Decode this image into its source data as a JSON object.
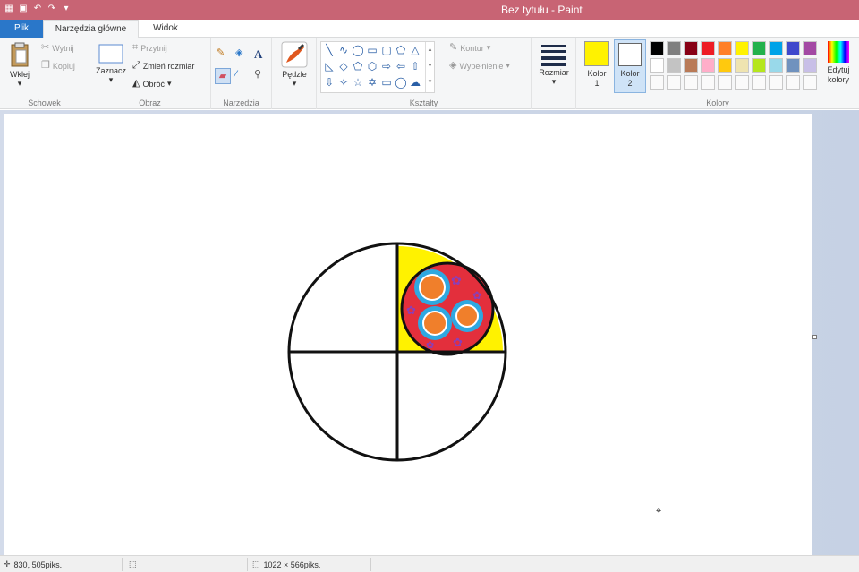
{
  "window": {
    "title": "Bez tytułu - Paint"
  },
  "tabs": {
    "file": "Plik",
    "home": "Narzędzia główne",
    "view": "Widok"
  },
  "groups": {
    "clipboard": {
      "label": "Schowek",
      "paste": "Wklej",
      "cut": "Wytnij",
      "copy": "Kopiuj"
    },
    "image": {
      "label": "Obraz",
      "select": "Zaznacz",
      "crop": "Przytnij",
      "resize": "Zmień rozmiar",
      "rotate": "Obróć"
    },
    "tools": {
      "label": "Narzędzia"
    },
    "brushes": {
      "label": "Pędzle"
    },
    "shapes": {
      "label": "Kształty",
      "outline": "Kontur",
      "fill": "Wypełnienie"
    },
    "size": {
      "label": "Rozmiar"
    },
    "colors": {
      "label": "Kolory",
      "color1": "Kolor\n1",
      "color2": "Kolor\n2",
      "edit": "Edytuj\nkolory",
      "color1_value": "#fff200",
      "color2_value": "#ffffff"
    }
  },
  "palette": {
    "row1": [
      "#000000",
      "#7f7f7f",
      "#880015",
      "#ed1c24",
      "#ff7f27",
      "#fff200",
      "#22b14c",
      "#00a2e8",
      "#3f48cc",
      "#a349a4"
    ],
    "row2": [
      "#ffffff",
      "#c3c3c3",
      "#b97a57",
      "#ffaec9",
      "#ffc90e",
      "#efe4b0",
      "#b5e61d",
      "#99d9ea",
      "#7092be",
      "#c8bfe7"
    ]
  },
  "status": {
    "position": "830, 505piks.",
    "selection": "",
    "canvas_size": "1022 × 566piks."
  }
}
